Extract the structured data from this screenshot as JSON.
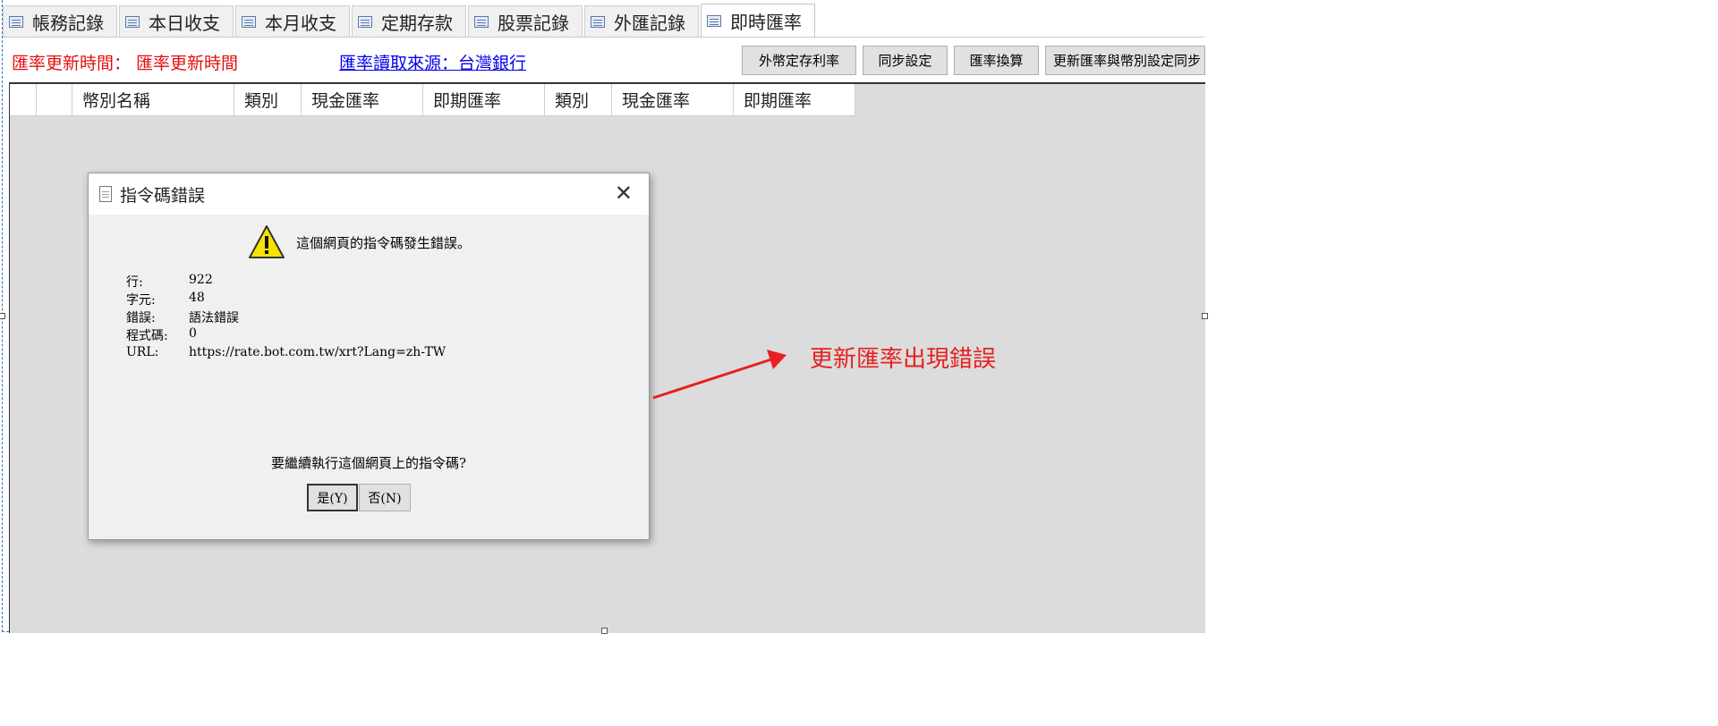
{
  "tabs": [
    "帳務記錄",
    "本日收支",
    "本月收支",
    "定期存款",
    "股票記錄",
    "外匯記錄",
    "即時匯率"
  ],
  "header": {
    "update_time_label": "匯率更新時間： 匯率更新時間",
    "source_link": "匯率讀取來源：台灣銀行"
  },
  "buttons": {
    "deposit_rates": "外幣定存利率",
    "sync_settings": "同步設定",
    "fx_convert": "匯率換算",
    "update_sync": "更新匯率與幣別設定同步"
  },
  "grid": {
    "columns": [
      "",
      "",
      "幣別名稱",
      "類別",
      "現金匯率",
      "即期匯率",
      "類別",
      "現金匯率",
      "即期匯率"
    ]
  },
  "dialog": {
    "title": "指令碼錯誤",
    "message": "這個網頁的指令碼發生錯誤。",
    "details": [
      {
        "key": "行:",
        "value": "922"
      },
      {
        "key": "字元:",
        "value": "48"
      },
      {
        "key": "錯誤:",
        "value": "語法錯誤"
      },
      {
        "key": "程式碼:",
        "value": "0"
      },
      {
        "key": "URL:",
        "value": "https://rate.bot.com.tw/xrt?Lang=zh-TW"
      }
    ],
    "prompt": "要繼續執行這個網頁上的指令碼?",
    "yes": "是(Y)",
    "no": "否(N)"
  },
  "annotation": {
    "text": "更新匯率出現錯誤",
    "color": "#e82020"
  }
}
